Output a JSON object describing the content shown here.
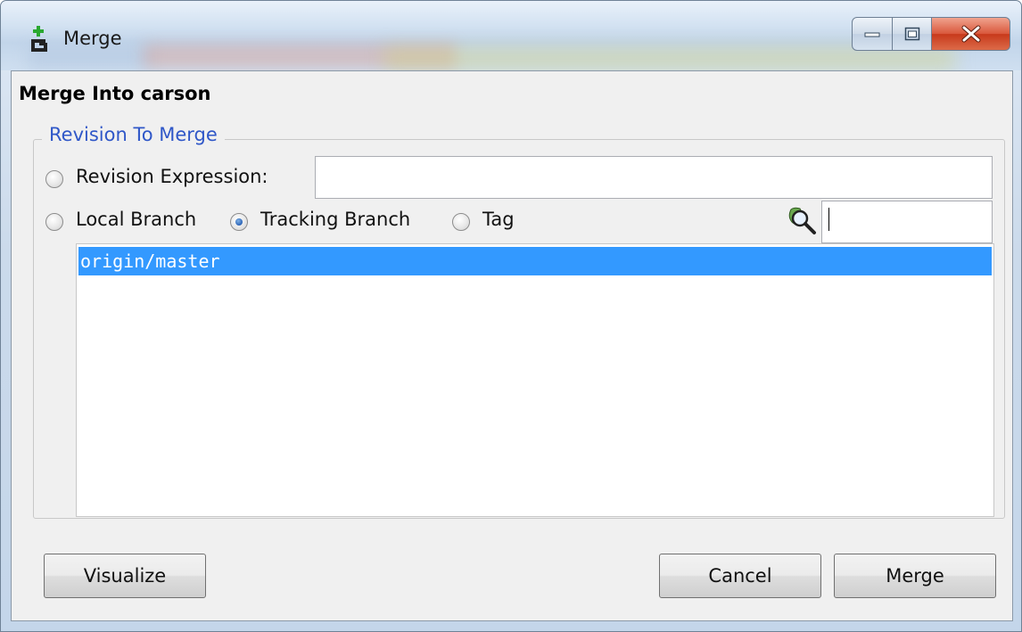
{
  "window": {
    "title": "Merge"
  },
  "dialog": {
    "heading": "Merge Into carson",
    "group_label": "Revision To Merge",
    "revision_expression_label": "Revision Expression:",
    "revision_expression_value": "",
    "options": {
      "local_branch": "Local Branch",
      "tracking_branch": "Tracking Branch",
      "tag": "Tag"
    },
    "selected_option": "tracking_branch",
    "filter_value": "",
    "branches": [
      "origin/master"
    ],
    "selected_branch_index": 0
  },
  "buttons": {
    "visualize": "Visualize",
    "cancel": "Cancel",
    "merge": "Merge"
  },
  "colors": {
    "selection": "#3399ff",
    "group_label": "#2f57c8",
    "close_button": "#c7391b"
  }
}
